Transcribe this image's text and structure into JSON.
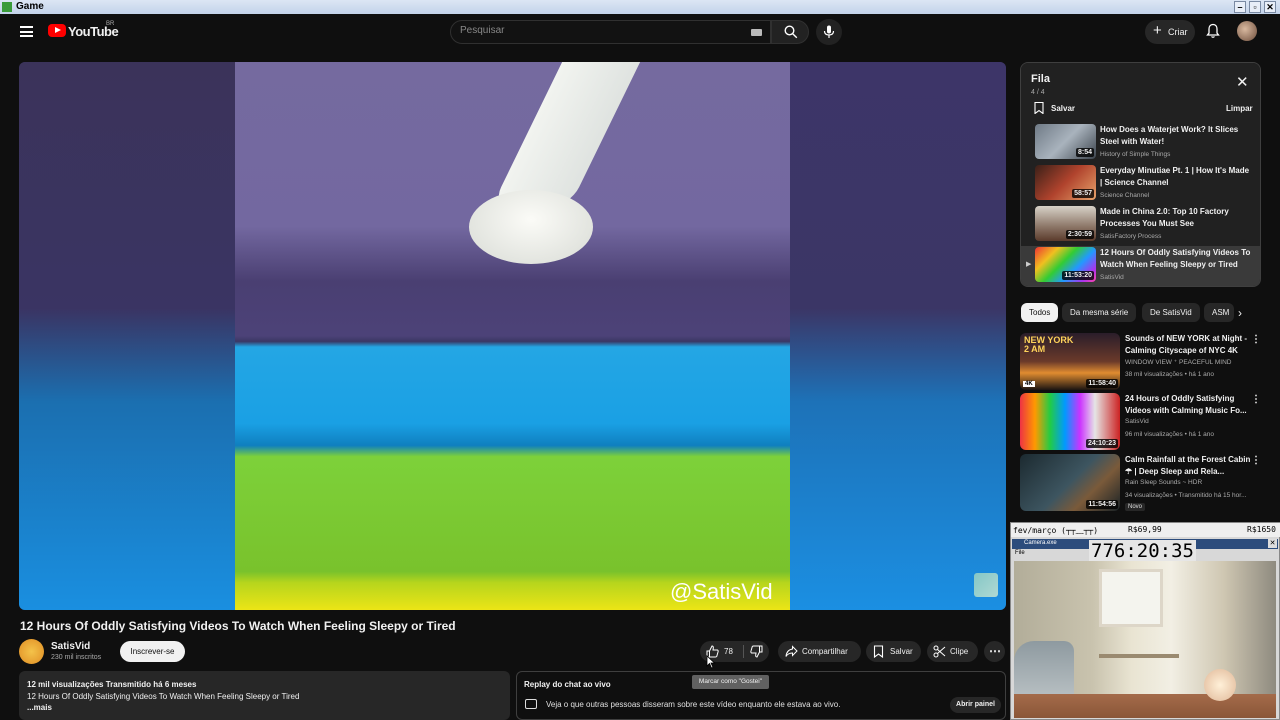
{
  "window": {
    "title": "Game"
  },
  "header": {
    "logo_text": "YouTube",
    "country_code": "BR",
    "search_placeholder": "Pesquisar",
    "create_label": "Criar"
  },
  "video": {
    "watermark": "@SatisVid",
    "title": "12 Hours Of Oddly Satisfying Videos To Watch When Feeling Sleepy or Tired",
    "channel_name": "SatisVid",
    "channel_subs": "230 mil inscritos",
    "subscribe_label": "Inscrever-se",
    "likes": "78",
    "share_label": "Compartilhar",
    "save_label": "Salvar",
    "clip_label": "Clipe",
    "like_tooltip": "Marcar como \"Gostei\""
  },
  "description": {
    "stats": "12 mil visualizações  Transmitido há 6 meses",
    "text": "12 Hours Of Oddly Satisfying Videos To Watch When Feeling Sleepy or Tired",
    "more": "...mais"
  },
  "chat_replay": {
    "title": "Replay do chat ao vivo",
    "subtitle": "Veja o que outras pessoas disseram sobre este vídeo enquanto ele estava ao vivo.",
    "open_label": "Abrir painel"
  },
  "queue": {
    "title": "Fila",
    "count": "4 / 4",
    "save_label": "Salvar",
    "clear_label": "Limpar",
    "items": [
      {
        "title": "How Does a Waterjet Work? It Slices Steel with Water!",
        "channel": "History of Simple Things",
        "duration": "8:54"
      },
      {
        "title": "Everyday Minutiae Pt. 1 | How It's Made | Science Channel",
        "channel": "Science Channel",
        "duration": "58:57"
      },
      {
        "title": "Made in China 2.0: Top 10 Factory Processes You Must See",
        "channel": "SatisFactory Process",
        "duration": "2:30:59"
      },
      {
        "title": "12 Hours Of Oddly Satisfying Videos To Watch When Feeling Sleepy or Tired",
        "channel": "SatisVid",
        "duration": "11:53:20"
      }
    ]
  },
  "chips": [
    "Todos",
    "Da mesma série",
    "De SatisVid",
    "ASM"
  ],
  "recommendations": [
    {
      "title": "Sounds of NEW YORK at Night - Calming Cityscape of NYC 4K",
      "channel": "WINDOW VIEW ⁺ PEACEFUL MIND",
      "meta": "38 mil visualizações • há 1 ano",
      "duration": "11:58:40",
      "thumb_text": "NEW YORK\n2 AM",
      "badge": "4K"
    },
    {
      "title": "24 Hours of Oddly Satisfying Videos with Calming Music Fo...",
      "channel": "SatisVid",
      "meta": "96 mil visualizações • há 1 ano",
      "duration": "24:10:23"
    },
    {
      "title": "Calm Rainfall at the Forest Cabin ☂ | Deep Sleep and Rela...",
      "channel": "Rain Sleep Sounds ~ HDR",
      "meta": "34 visualizações • Transmitido há 15 hor...",
      "duration": "11:54:56",
      "badge_new": "Novo"
    }
  ],
  "overlay": {
    "top_left": "fev/março (┬┬﹏┬┬)",
    "top_mid": "R$69,99",
    "top_right": "R$1650",
    "cam_title": "Camera.exe",
    "file_menu": "File",
    "timer": "776:20:35"
  },
  "colors": {
    "accent": "#ff0000",
    "background": "#0f0f0f",
    "chip_selected": "#f1f1f1"
  }
}
